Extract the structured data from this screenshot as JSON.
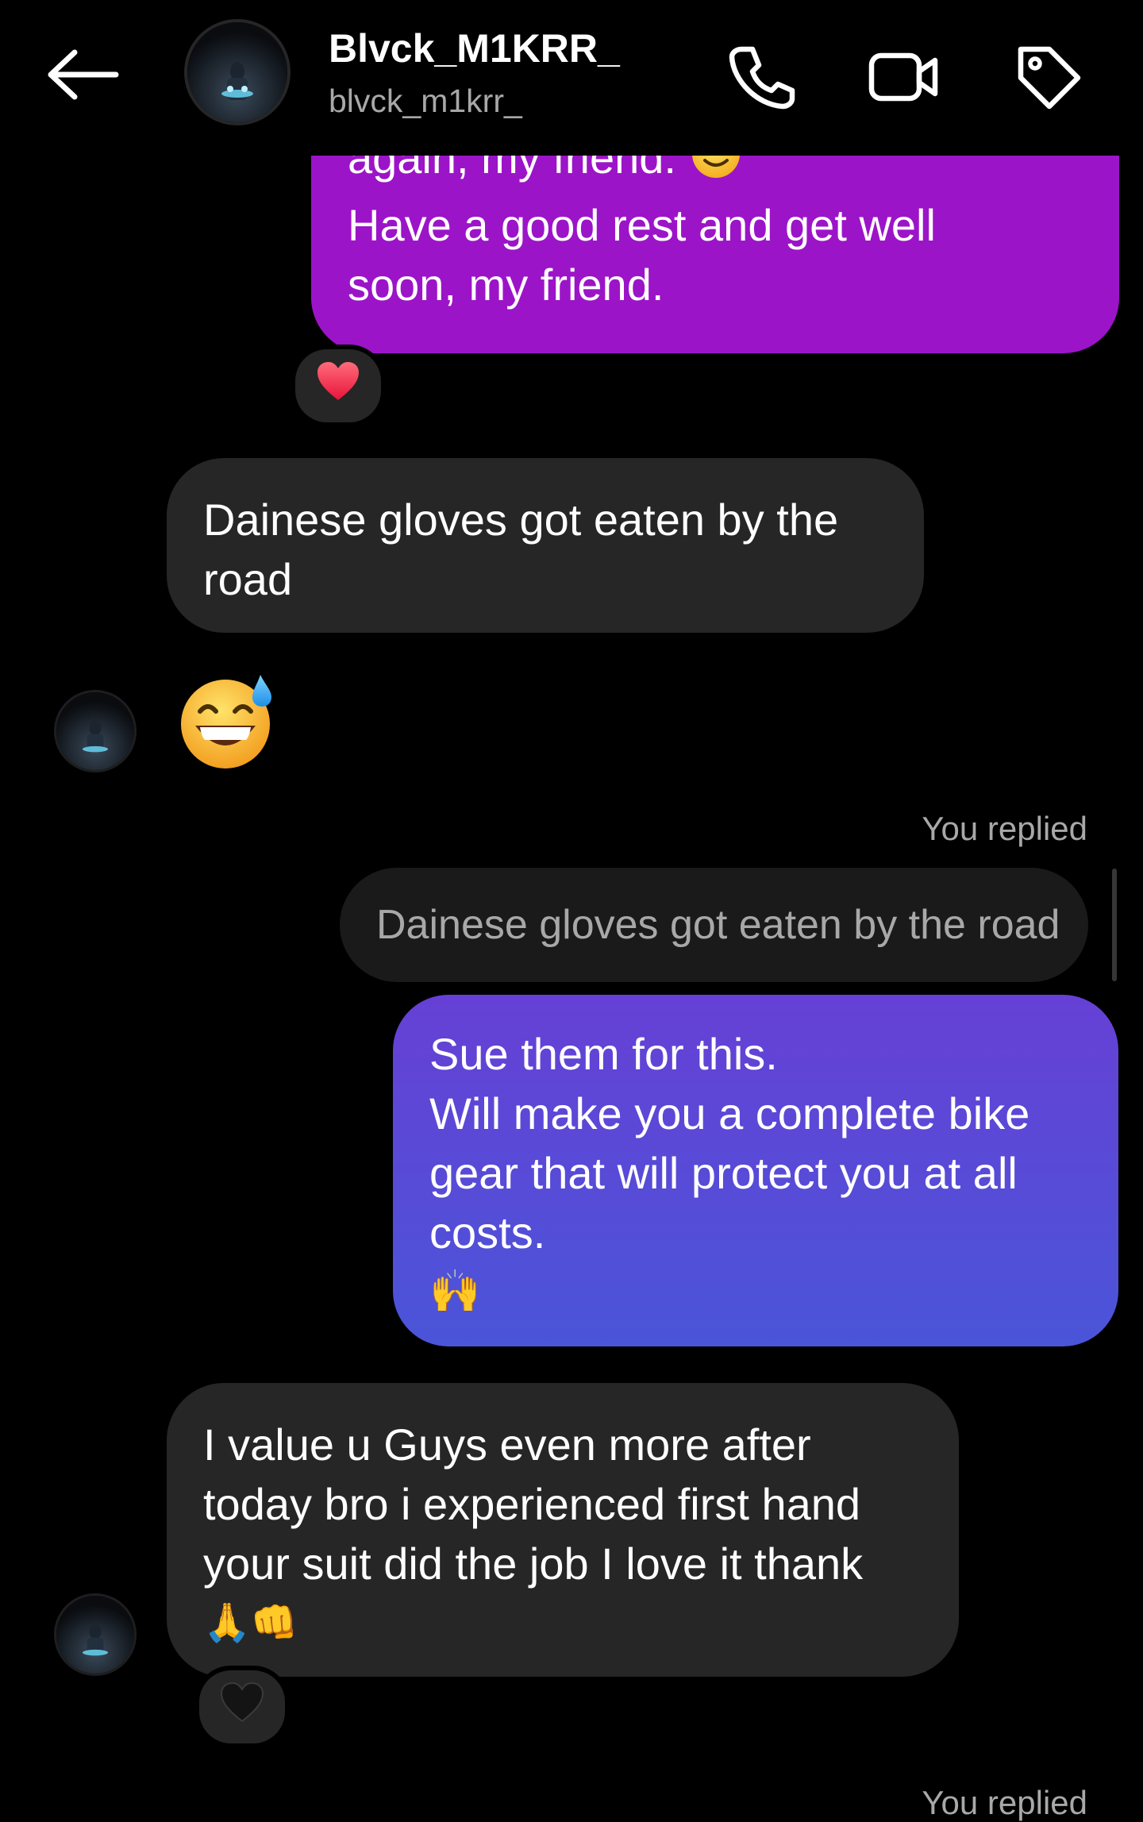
{
  "header": {
    "contact_name": "Blvck_M1KRR_",
    "contact_handle": "blvck_m1krr_",
    "icons": [
      "back-arrow-icon",
      "phone-icon",
      "video-call-icon",
      "tag-icon"
    ]
  },
  "messages": [
    {
      "direction": "outgoing",
      "lines": [
        "again, my friend.",
        "Have a good rest and get well",
        "soon, my friend."
      ],
      "emoji": "slightly-smiling-face",
      "reaction": "❤️",
      "color": "#9c14c8"
    },
    {
      "direction": "incoming",
      "lines": [
        "Dainese gloves got eaten by the",
        "road"
      ]
    },
    {
      "direction": "incoming",
      "emoji_only": "grinning-face-with-sweat"
    },
    {
      "direction": "outgoing",
      "replied_label": "You replied",
      "quote": "Dainese gloves got eaten by the road",
      "lines": [
        "Sue them for this.",
        "Will make you a complete bike",
        "gear that will protect you at all",
        "costs."
      ],
      "emoji": "🙌",
      "color_top": "#6640d6",
      "color_bottom": "#4a55d8"
    },
    {
      "direction": "incoming",
      "lines": [
        "I value u Guys even more after",
        "today bro i experienced first hand",
        "your suit did the job I love it thank"
      ],
      "emoji": "🙏👊",
      "reaction": "🖤"
    },
    {
      "direction": "outgoing",
      "replied_label": "You replied"
    }
  ]
}
